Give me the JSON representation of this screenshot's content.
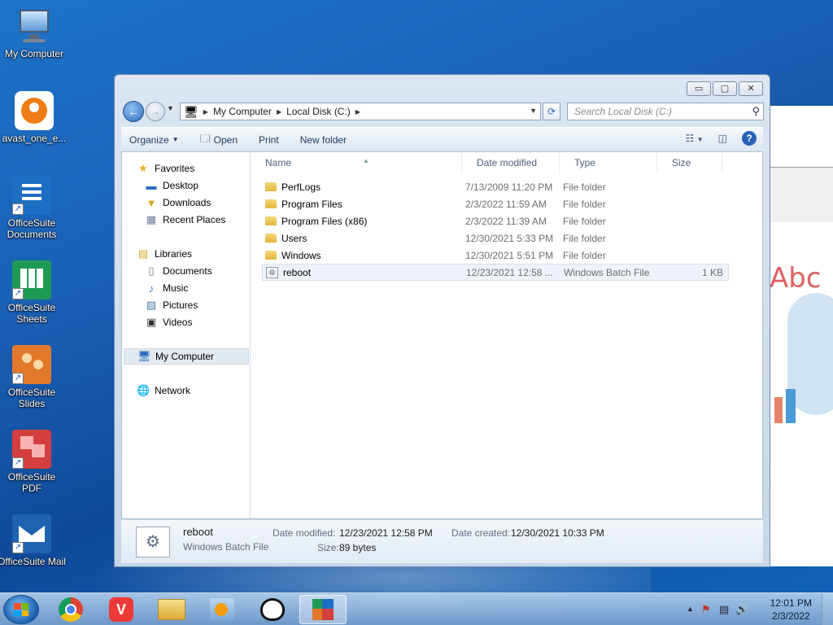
{
  "desktop": {
    "icons": [
      {
        "label": "My Computer"
      },
      {
        "label": "avast_one_e..."
      },
      {
        "label": "OfficeSuite Documents"
      },
      {
        "label": "OfficeSuite Sheets"
      },
      {
        "label": "OfficeSuite Slides"
      },
      {
        "label": "OfficeSuite PDF"
      },
      {
        "label": "OfficeSuite Mail"
      }
    ],
    "background_app_text": "Abc"
  },
  "window": {
    "caption": {
      "minimize": "▭",
      "restore": "▢",
      "close": "✕"
    },
    "address": {
      "crumbs": [
        "My Computer",
        "Local Disk (C:)"
      ],
      "separator": "▶",
      "refresh": "⟳"
    },
    "search": {
      "placeholder": "Search Local Disk (C:)"
    },
    "toolbar": {
      "organize": "Organize",
      "open": "Open",
      "print": "Print",
      "new_folder": "New folder"
    },
    "nav": {
      "favorites": "Favorites",
      "desktop": "Desktop",
      "downloads": "Downloads",
      "recent_places": "Recent Places",
      "libraries": "Libraries",
      "documents": "Documents",
      "music": "Music",
      "pictures": "Pictures",
      "videos": "Videos",
      "my_computer": "My Computer",
      "network": "Network"
    },
    "columns": {
      "name": "Name",
      "date": "Date modified",
      "type": "Type",
      "size": "Size"
    },
    "files": [
      {
        "name": "PerfLogs",
        "date": "7/13/2009 11:20 PM",
        "type": "File folder",
        "size": "",
        "kind": "folder"
      },
      {
        "name": "Program Files",
        "date": "2/3/2022 11:59 AM",
        "type": "File folder",
        "size": "",
        "kind": "folder"
      },
      {
        "name": "Program Files (x86)",
        "date": "2/3/2022 11:39 AM",
        "type": "File folder",
        "size": "",
        "kind": "folder"
      },
      {
        "name": "Users",
        "date": "12/30/2021 5:33 PM",
        "type": "File folder",
        "size": "",
        "kind": "folder"
      },
      {
        "name": "Windows",
        "date": "12/30/2021 5:51 PM",
        "type": "File folder",
        "size": "",
        "kind": "folder"
      },
      {
        "name": "reboot",
        "date": "12/23/2021 12:58 ...",
        "type": "Windows Batch File",
        "size": "1 KB",
        "kind": "batch"
      }
    ],
    "selected_file": "reboot",
    "details": {
      "name": "reboot",
      "type": "Windows Batch File",
      "date_modified_label": "Date modified:",
      "date_modified": "12/23/2021 12:58 PM",
      "date_created_label": "Date created:",
      "date_created": "12/30/2021 10:33 PM",
      "size_label": "Size:",
      "size": "89 bytes"
    }
  },
  "taskbar": {
    "apps": [
      "chrome-icon",
      "vivaldi-icon",
      "explorer-icon",
      "media-player-icon",
      "ccleaner-icon",
      "officesuite-icon"
    ],
    "active_app": "officesuite-icon",
    "clock": {
      "time": "12:01 PM",
      "date": "2/3/2022"
    }
  },
  "colors": {
    "accent": "#2c6fbf",
    "desktop": "#1a5fb4",
    "selection": "#eef3f9"
  }
}
